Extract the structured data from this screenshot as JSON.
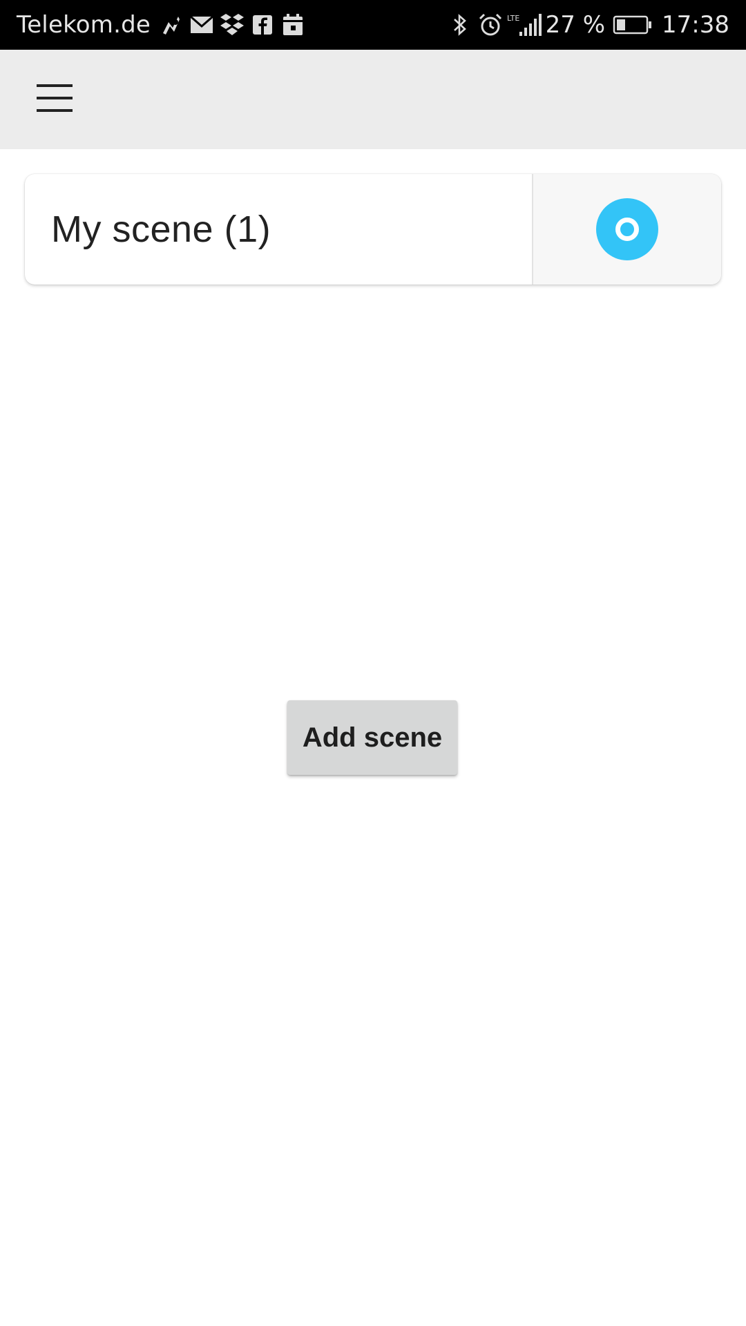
{
  "status_bar": {
    "carrier": "Telekom.de",
    "battery_percent": "27 %",
    "time": "17:38",
    "network": "LTE",
    "left_icons": [
      "avast-icon",
      "mail-icon",
      "dropbox-icon",
      "facebook-icon",
      "calendar-icon"
    ],
    "right_icons": [
      "bluetooth-icon",
      "alarm-icon",
      "signal-icon",
      "battery-icon"
    ]
  },
  "app_bar": {
    "menu_icon": "hamburger-menu-icon"
  },
  "scenes": [
    {
      "name": "My scene (1)",
      "action_icon": "activate-scene-icon"
    }
  ],
  "add_scene": {
    "label": "Add scene"
  },
  "colors": {
    "accent": "#33c4f7",
    "app_bar_bg": "#ececec",
    "button_bg": "#d6d7d7",
    "status_bar_bg": "#000000"
  }
}
